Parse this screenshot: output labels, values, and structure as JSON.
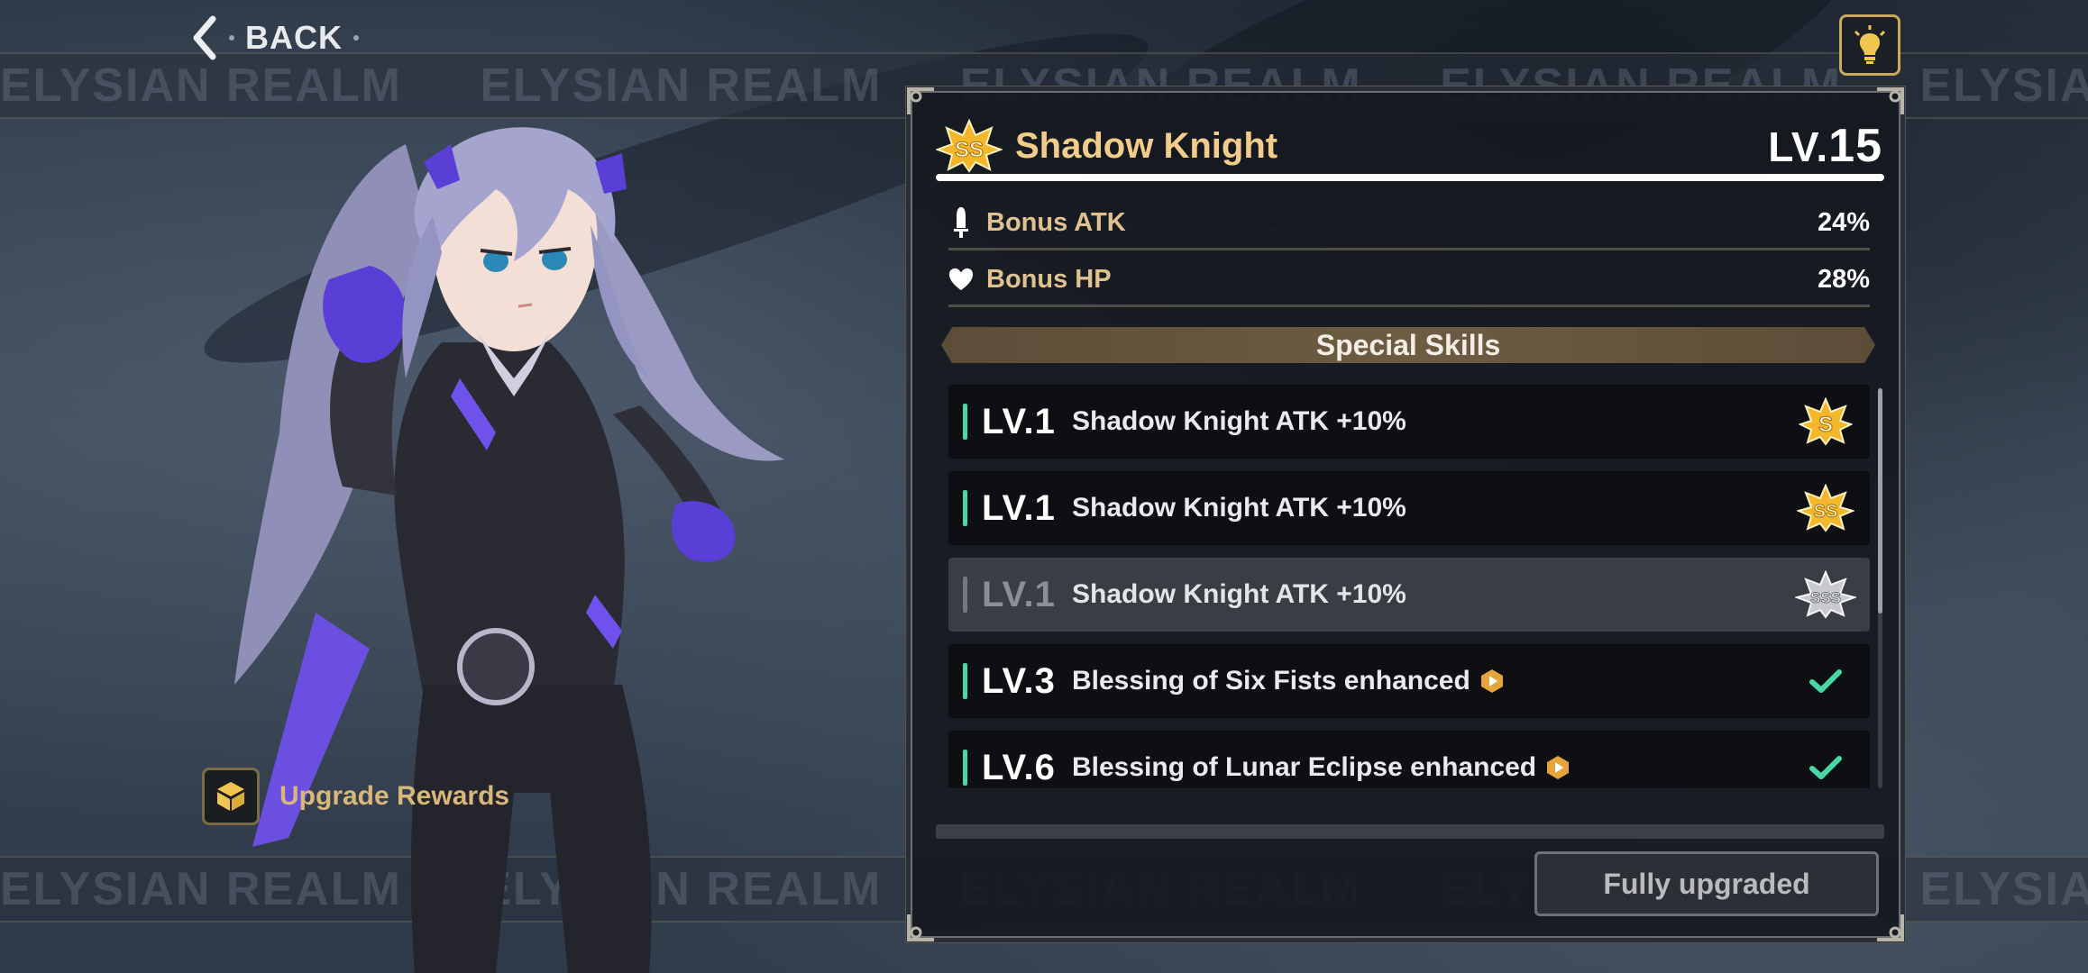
{
  "background": {
    "watermark_text": "ELYSIAN REALM"
  },
  "topbar": {
    "back_label": "BACK"
  },
  "character": {
    "icon": "character-portrait"
  },
  "upgrade_rewards": {
    "label": "Upgrade Rewards"
  },
  "panel": {
    "rank": "SS",
    "title": "Shadow Knight",
    "level_prefix": "LV.",
    "level_value": "15",
    "stats": [
      {
        "icon": "sword-icon",
        "label": "Bonus ATK",
        "value": "24%"
      },
      {
        "icon": "heart-icon",
        "label": "Bonus HP",
        "value": "28%"
      }
    ],
    "section_title": "Special Skills",
    "skills": [
      {
        "level": "LV.1",
        "description": "Shadow Knight ATK +10%",
        "end": "S",
        "locked": false,
        "play_icon": false
      },
      {
        "level": "LV.1",
        "description": "Shadow Knight ATK +10%",
        "end": "SS",
        "locked": false,
        "play_icon": false
      },
      {
        "level": "LV.1",
        "description": "Shadow Knight ATK +10%",
        "end": "SSS",
        "locked": true,
        "play_icon": false
      },
      {
        "level": "LV.3",
        "description": "Blessing of Six Fists enhanced",
        "end": "check",
        "locked": false,
        "play_icon": true
      },
      {
        "level": "LV.6",
        "description": "Blessing of Lunar Eclipse enhanced",
        "end": "check",
        "locked": false,
        "play_icon": true
      }
    ],
    "fully_upgraded_label": "Fully upgraded"
  },
  "colors": {
    "accent_gold": "#f2cc8b",
    "accent_green": "#47d9a4"
  }
}
